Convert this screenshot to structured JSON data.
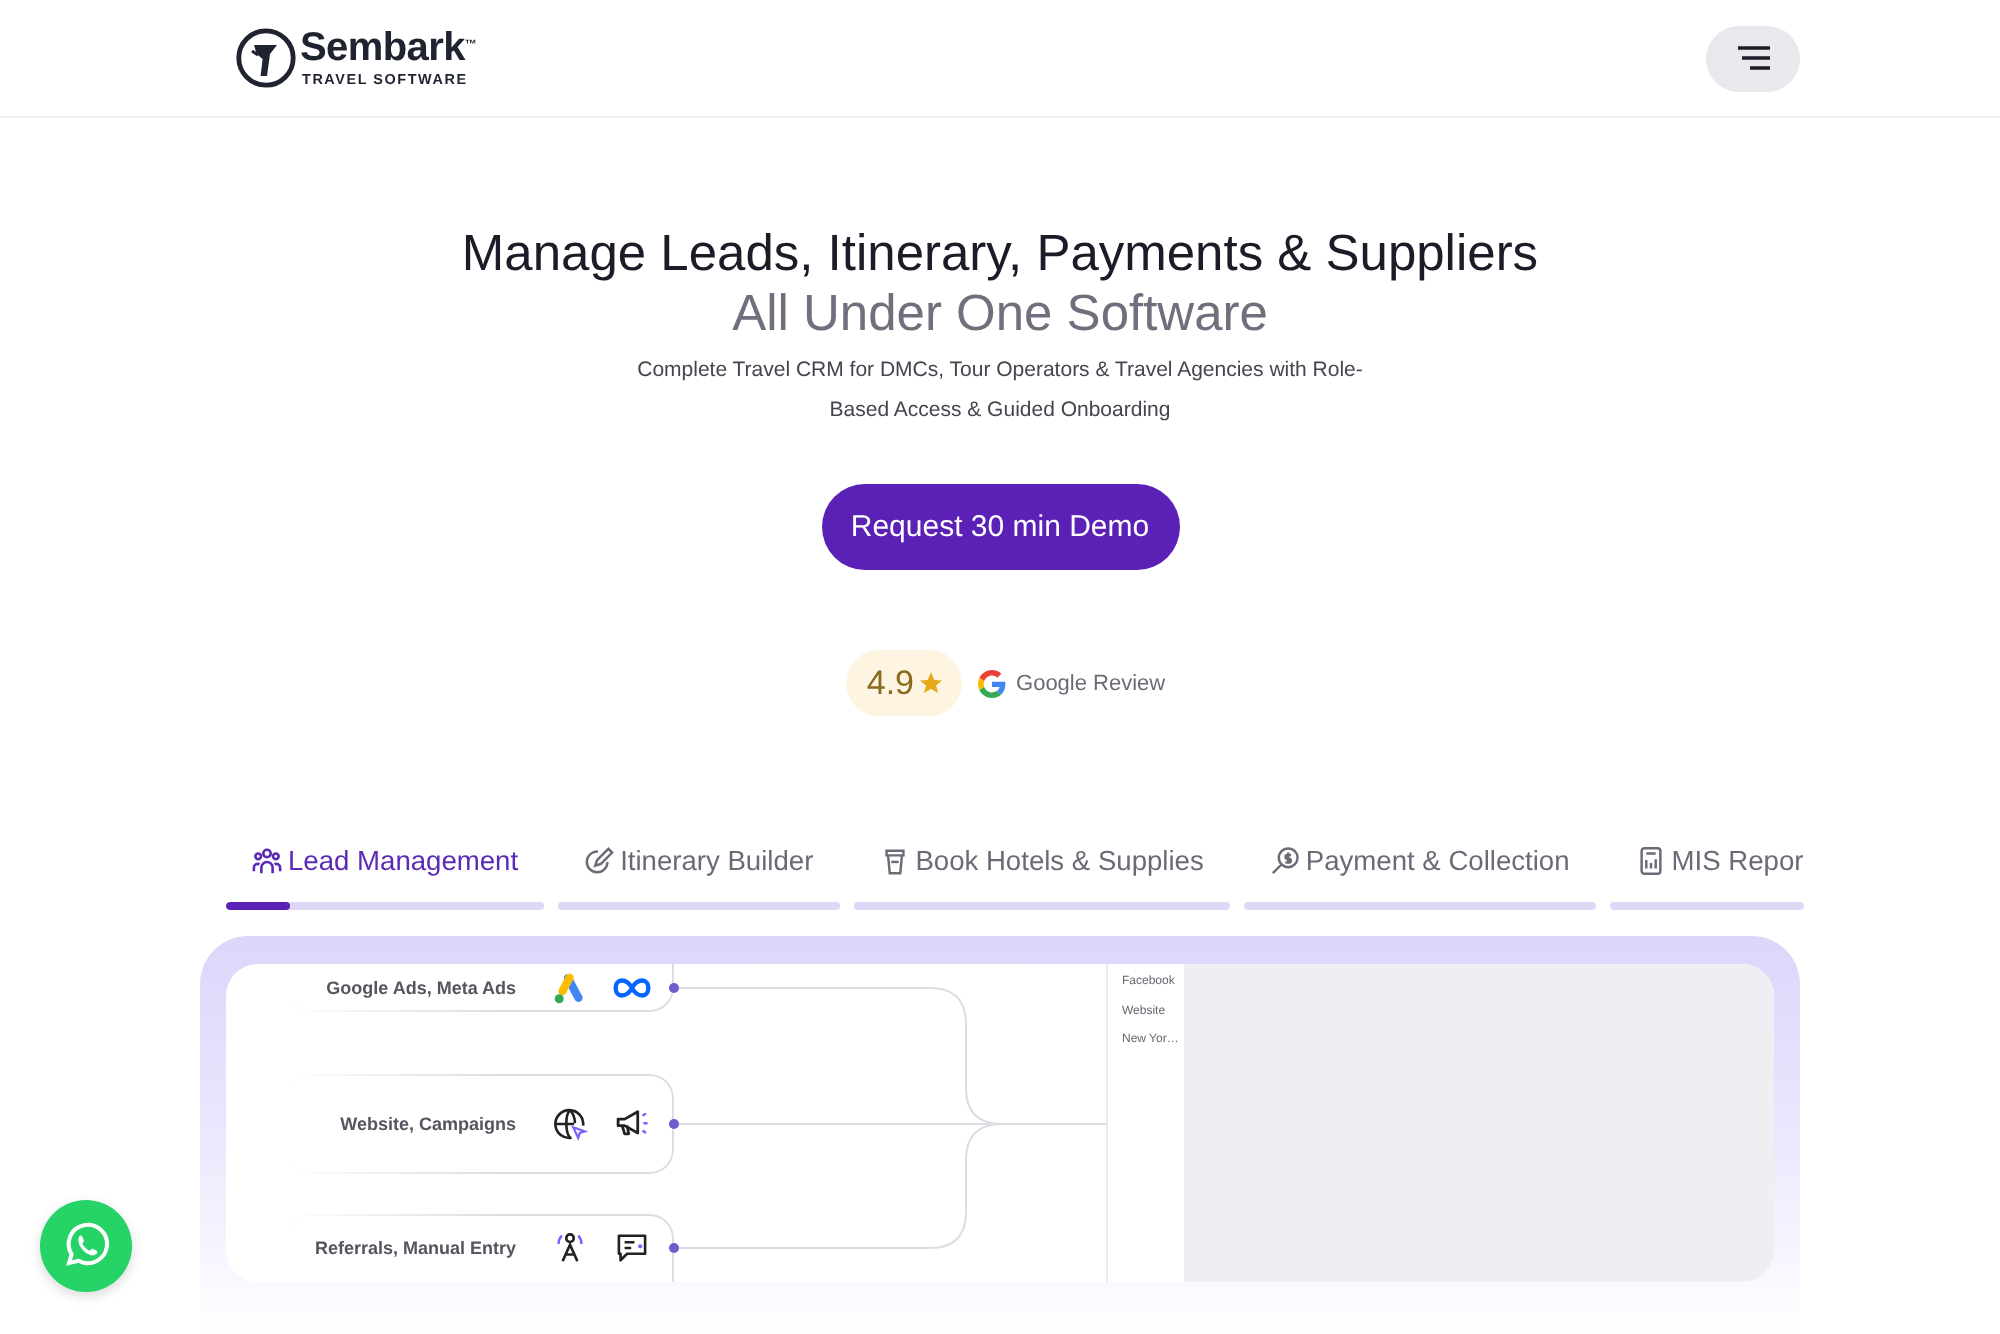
{
  "header": {
    "brand": "Sembark$^{™}$",
    "tagline": "TRAVEL SOFTWARE"
  },
  "hero": {
    "title": "Manage Leads, Itinerary, Payments & Suppliers",
    "subtitle": "All Under One Software",
    "description": "Complete Travel CRM for DMCs, Tour Operators & Travel Agencies with Role-Based Access & Guided Onboarding",
    "cta": "Request 30 min Demo",
    "rating": {
      "score": "4.9",
      "source": "Google Review"
    }
  },
  "feature_tabs": [
    {
      "label": "Lead Management",
      "selected": true,
      "level": 0.2
    },
    {
      "label": "Itinerary Builder",
      "selected": false
    },
    {
      "label": "Book Hotels & Supplies",
      "selected": false
    },
    {
      "label": "Payment & Collection",
      "selected": false
    },
    {
      "label": "MIS Repor",
      "selected": false
    }
  ],
  "showcase": {
    "sources": [
      {
        "label": "Google Ads, Meta Ads"
      },
      {
        "label": "Website, Campaigns"
      },
      {
        "label": "Referrals, Manual Entry"
      }
    ],
    "list_items": [
      "Facebook",
      "Website",
      "New Yor…"
    ]
  }
}
